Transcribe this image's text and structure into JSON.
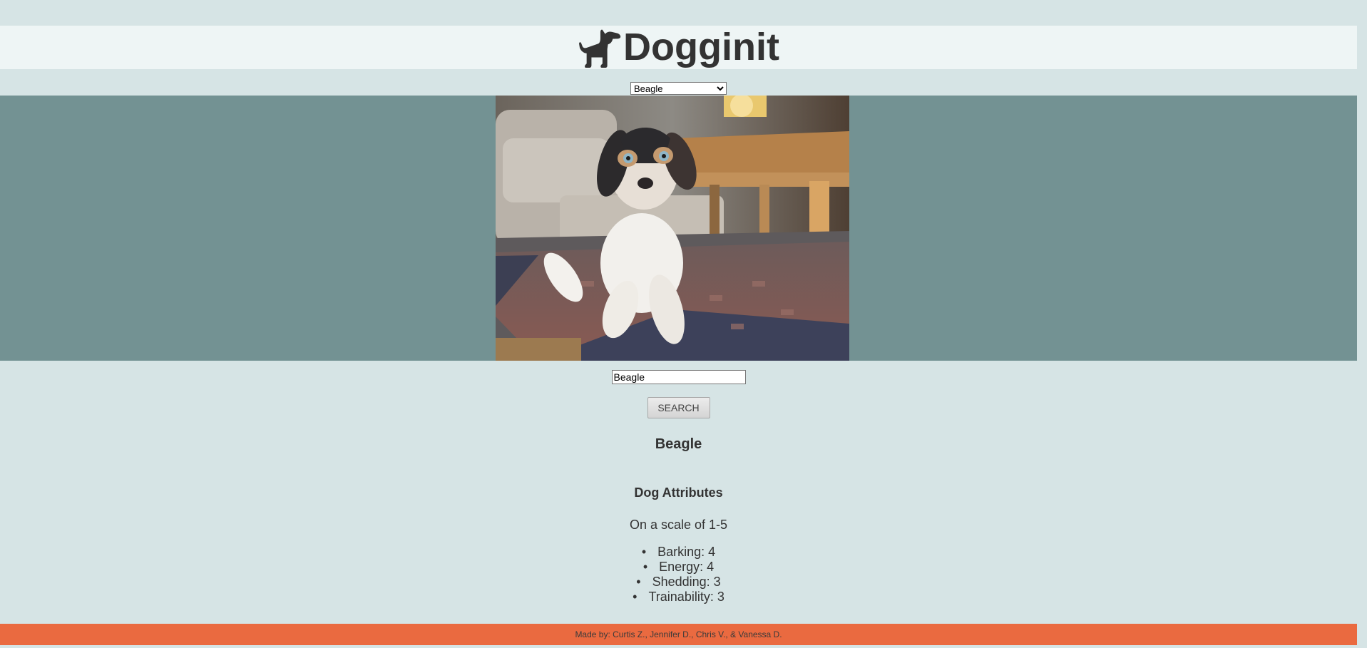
{
  "header": {
    "title": "Dogginit",
    "logo_icon": "dog-icon"
  },
  "breed_select": {
    "selected": "Beagle",
    "options": [
      "Beagle"
    ]
  },
  "gallery": {
    "photo_subject": "beagle-puppy-photo"
  },
  "search": {
    "input_value": "Beagle",
    "button_label": "SEARCH"
  },
  "breed": {
    "name": "Beagle"
  },
  "attributes": {
    "title": "Dog Attributes",
    "scale_note": "On a scale of 1-5",
    "items": [
      {
        "label": "Barking: 4"
      },
      {
        "label": "Energy: 4"
      },
      {
        "label": "Shedding: 3"
      },
      {
        "label": "Trainability: 3"
      }
    ]
  },
  "footer": {
    "credits": "Made by: Curtis Z., Jennifer D., Chris V., & Vanessa D."
  },
  "colors": {
    "page_bg": "#d6e4e5",
    "header_bg": "#eef5f5",
    "gallery_bg": "#739293",
    "footer_bg": "#ea6a40",
    "text": "#333333"
  }
}
